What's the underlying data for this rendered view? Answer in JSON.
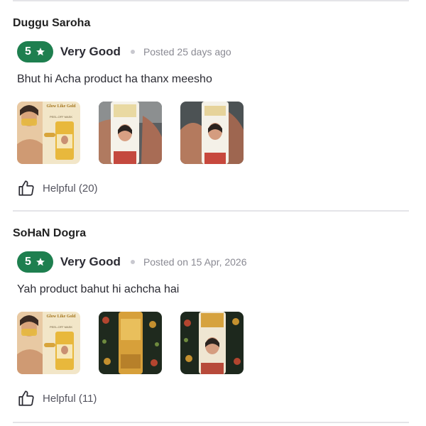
{
  "reviews": [
    {
      "name": "Duggu Saroha",
      "rating": "5",
      "rating_word": "Very Good",
      "posted": "Posted 25 days ago",
      "text": "Bhut hi Acha product ha thanx meesho",
      "helpful": "Helpful (20)",
      "photo_panel_text": [
        "Glow Like Gold",
        "PEEL-OFF MASK"
      ]
    },
    {
      "name": "SoHaN Dogra",
      "rating": "5",
      "rating_word": "Very Good",
      "posted": "Posted on 15 Apr, 2026",
      "text": "Yah product bahut hi achcha hai",
      "helpful": "Helpful (11)",
      "photo_panel_text": [
        "Glow Like Gold",
        "PEEL-OFF MASK"
      ]
    }
  ],
  "colors": {
    "rating_badge": "#1e7f4f",
    "divider": "#e4e4e8",
    "muted_text": "#8a8a93"
  }
}
